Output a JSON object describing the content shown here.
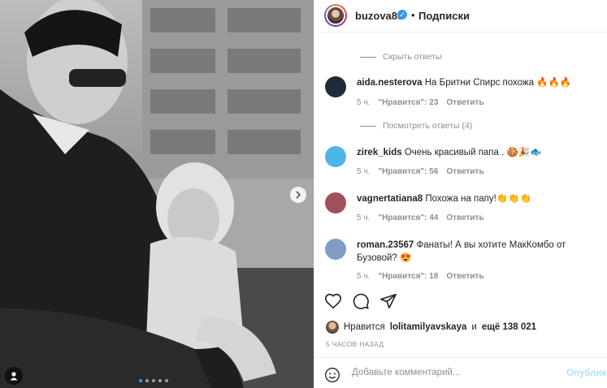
{
  "post": {
    "username": "buzova86",
    "verified_mark": "✓",
    "separator": "•",
    "follow_label": "Подписки",
    "image_dots": 5,
    "active_dot": 0
  },
  "replies": {
    "hide_label": "Скрыть ответы",
    "view_label": "Посмотреть ответы (4)"
  },
  "comments": [
    {
      "user": "aida.nesterova",
      "text": "На Бритни Спирс похожа 🔥🔥🔥",
      "time": "5 ч.",
      "likes": "\"Нравится\": 23",
      "reply": "Ответить",
      "avatar_color": "#1d2b3a"
    },
    {
      "user": "zirek_kids",
      "text": "Очень красивый папа . 🍪🎉🐟",
      "time": "5 ч.",
      "likes": "\"Нравится\": 56",
      "reply": "Ответить",
      "avatar_color": "#4db6e8"
    },
    {
      "user": "vagnertatiana8",
      "text": "Похожа на папу!👏👏👏",
      "time": "5 ч.",
      "likes": "\"Нравится\": 44",
      "reply": "Ответить",
      "avatar_color": "#a0505a"
    },
    {
      "user": "roman.23567",
      "text": "Фанаты! А вы хотите МакКомбо от Бузовой? 😍",
      "time": "5 ч.",
      "likes": "\"Нравится\": 18",
      "reply": "Ответить",
      "avatar_color": "#7f9dc7"
    }
  ],
  "likes_line": {
    "prefix": "Нравится",
    "user": "lolitamilyavskaya",
    "middle": "и",
    "others": "ещё 138 021"
  },
  "timestamp": "5 ЧАСОВ НАЗАД",
  "add_comment": {
    "placeholder": "Добавьте комментарий...",
    "publish_label": "Опублико"
  },
  "icons": {
    "like": "heart-icon",
    "comment": "comment-icon",
    "share": "send-icon",
    "emoji": "smiley-icon",
    "tag": "user-tag-icon",
    "next": "chevron-right-icon"
  }
}
